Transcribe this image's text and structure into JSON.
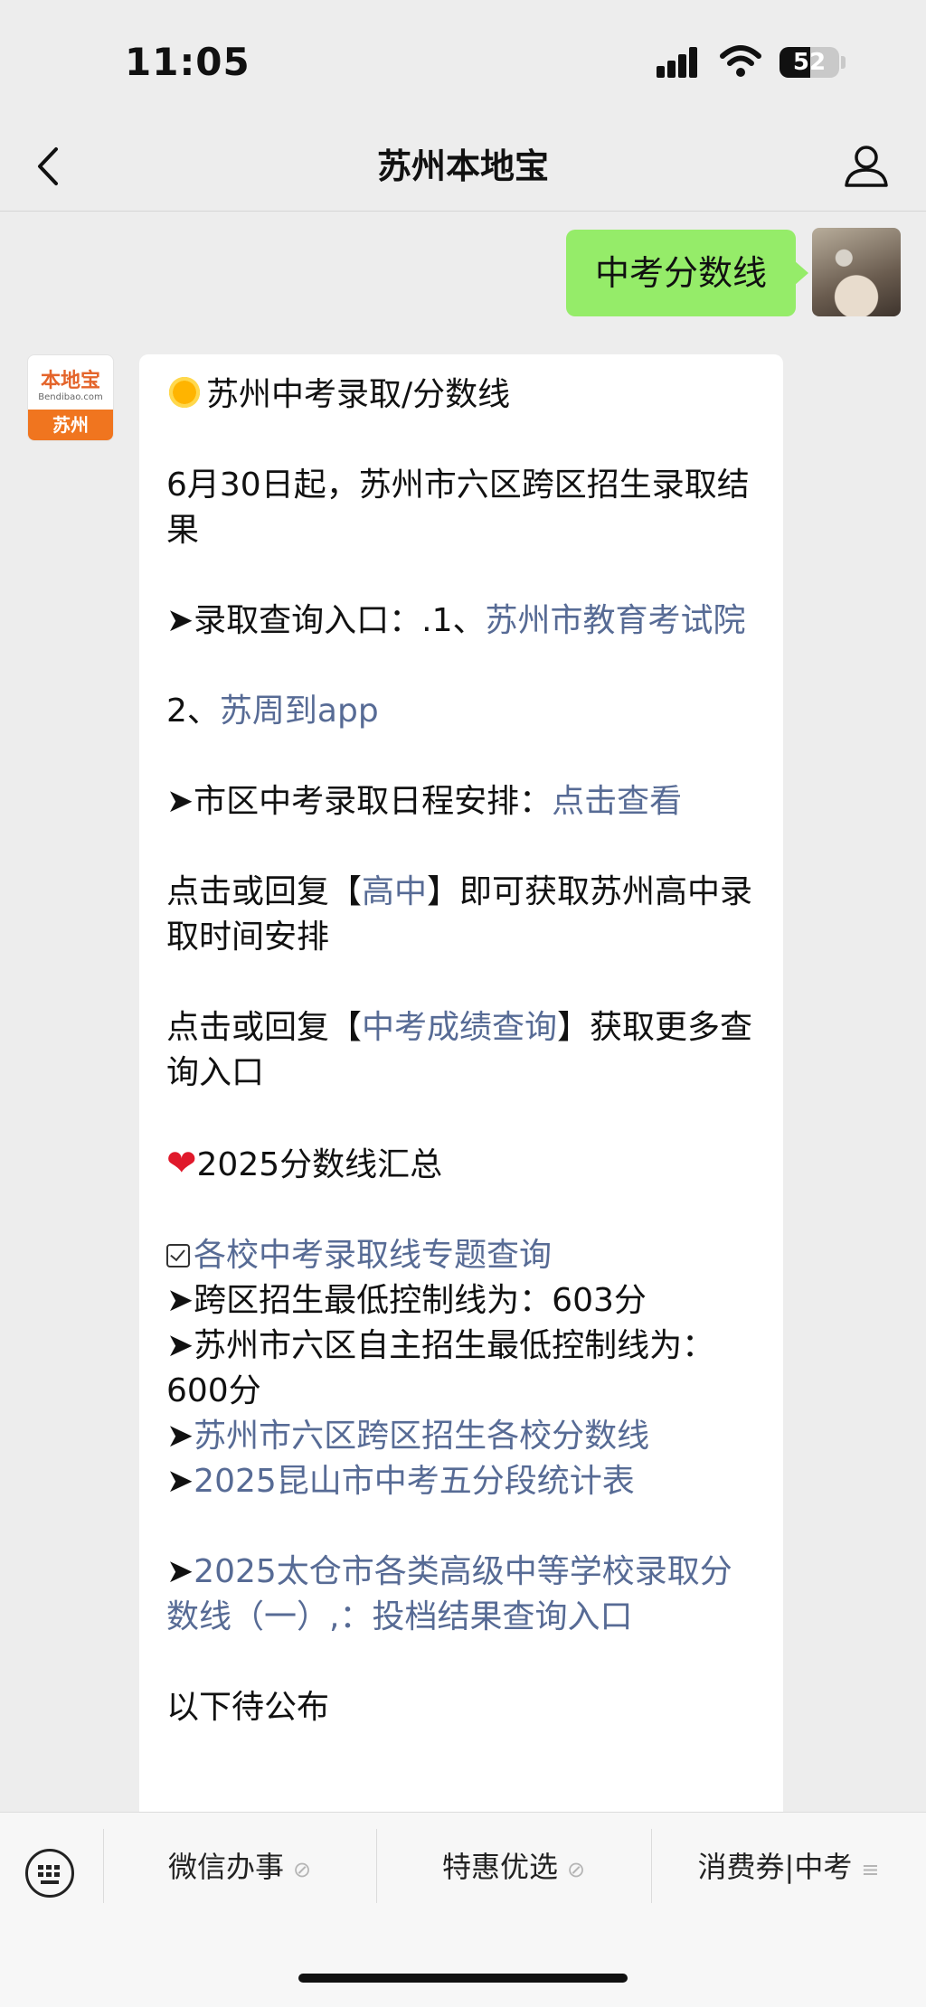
{
  "status_bar": {
    "time": "11:05",
    "battery": "52",
    "battery_level_percent": 52
  },
  "nav": {
    "title": "苏州本地宝"
  },
  "outgoing_message": {
    "text": "中考分数线"
  },
  "bot_avatar": {
    "logo_text": "本地宝",
    "domain_text": "Bendibao.com",
    "city": "苏州"
  },
  "reply": {
    "heading": "苏州中考录取/分数线",
    "p1": "6月30日起，苏州市六区跨区招生录取结果",
    "query_prefix": "➤录取查询入口：.1、",
    "query_link1": "苏州市教育考试院",
    "query2_prefix": "2、",
    "query_link2": "苏周到app",
    "schedule_prefix": "➤市区中考录取日程安排：",
    "schedule_link": "点击查看",
    "reply1_prefix": "点击或回复【",
    "reply1_link": "高中",
    "reply1_suffix": "】即可获取苏州高中录取时间安排",
    "reply2_prefix": "点击或回复【",
    "reply2_link": "中考成绩查询",
    "reply2_suffix": "】获取更多查询入口",
    "summary_heading": "2025分数线汇总",
    "check_link": "各校中考录取线专题查询",
    "line1": "➤跨区招生最低控制线为：603分",
    "line2": "➤苏州市六区自主招生最低控制线为：600分",
    "arrow": "➤",
    "link3": "苏州市六区跨区招生各校分数线",
    "link4": "2025昆山市中考五分段统计表",
    "link5": "2025太仓市各类高级中等学校录取分数线（一）,：投档结果查询入口",
    "pending": "以下待公布"
  },
  "menu": {
    "items": [
      "微信办事",
      "特惠优选",
      "消费券|中考"
    ]
  },
  "icons": [
    "back-icon",
    "person-icon",
    "keyboard-icon",
    "link-icon",
    "menu-icon",
    "sun-emoji",
    "heart-emoji",
    "checkbox-icon"
  ],
  "colors": {
    "background": "#ededed",
    "outgoing_bubble": "#95ec69",
    "link": "#576b95",
    "brand_orange": "#f0751f"
  }
}
